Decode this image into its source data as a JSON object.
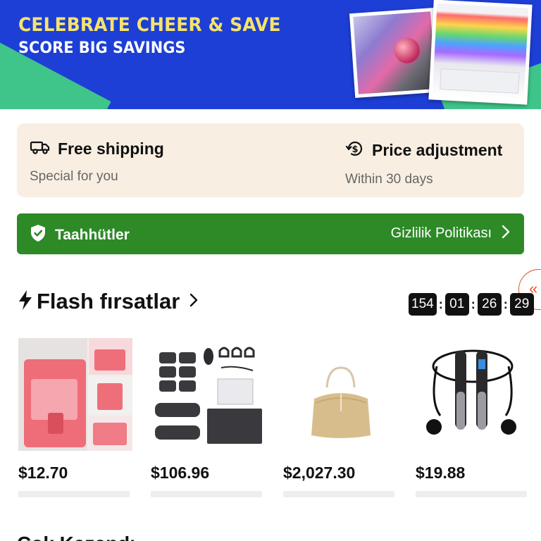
{
  "banner": {
    "headline": "CELEBRATE CHEER & SAVE",
    "subheadline": "SCORE BIG SAVINGS"
  },
  "info_card": {
    "shipping_title": "Free shipping",
    "shipping_subtitle": "Special for you",
    "price_title": "Price adjustment",
    "price_subtitle": "Within 30 days",
    "shipping_icon": "truck-icon",
    "price_icon": "price-refresh-icon"
  },
  "commitments": {
    "label": "Taahhütler",
    "link_label": "Gizlilik Politikası",
    "bar_color": "#2d8a27"
  },
  "flash": {
    "title": "Flash fırsatlar",
    "timer": [
      "154",
      "01",
      "26",
      "29"
    ]
  },
  "products": [
    {
      "price": "$12.70",
      "name": "pink-shoe-bag"
    },
    {
      "price": "$106.96",
      "name": "ems-abs-trainer"
    },
    {
      "price": "$2,027.30",
      "name": "gold-bucket-bag"
    },
    {
      "price": "$19.88",
      "name": "jump-rope"
    }
  ],
  "next_section": {
    "title": "Çok Kazandı"
  },
  "colors": {
    "banner_blue": "#1d3fd6",
    "banner_yellow": "#f6e36a",
    "accent_orange": "#e9552f",
    "card_beige": "#f8efe2"
  }
}
